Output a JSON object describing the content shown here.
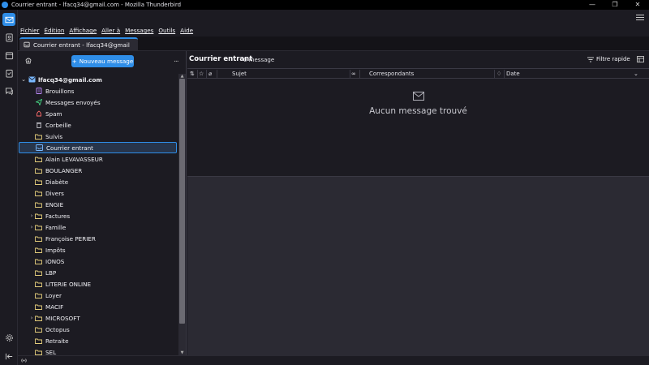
{
  "window": {
    "title": "Courrier entrant - lfacq34@gmail.com - Mozilla Thunderbird",
    "controls": [
      "—",
      "❐",
      "✕"
    ]
  },
  "menubar": [
    "Fichier",
    "Édition",
    "Affichage",
    "Aller à",
    "Messages",
    "Outils",
    "Aide"
  ],
  "tab": {
    "label": "Courrier entrant - lfacq34@gmail"
  },
  "folderpane": {
    "compose_label": "Nouveau message",
    "compose_plus": "+",
    "more": "...",
    "account": "lfacq34@gmail.com",
    "folders": [
      {
        "label": "Brouillons",
        "icon": "draft-icon",
        "color": "#c08cff",
        "expandable": false
      },
      {
        "label": "Messages envoyés",
        "icon": "sent-icon",
        "color": "#45d483",
        "expandable": false
      },
      {
        "label": "Spam",
        "icon": "spam-icon",
        "color": "#ff6b6b",
        "expandable": false
      },
      {
        "label": "Corbeille",
        "icon": "trash-icon",
        "color": "#c8c8cf",
        "expandable": false
      },
      {
        "label": "Suivis",
        "icon": "folder-icon",
        "color": "#e3cc7a",
        "expandable": false
      },
      {
        "label": "Courrier entrant",
        "icon": "inbox-icon",
        "color": "#79b8ff",
        "expandable": false,
        "selected": true
      },
      {
        "label": "Alain LEVAVASSEUR",
        "icon": "folder-icon",
        "color": "#e3cc7a",
        "expandable": false
      },
      {
        "label": "BOULANGER",
        "icon": "folder-icon",
        "color": "#e3cc7a",
        "expandable": false
      },
      {
        "label": "Diabète",
        "icon": "folder-icon",
        "color": "#e3cc7a",
        "expandable": false
      },
      {
        "label": "Divers",
        "icon": "folder-icon",
        "color": "#e3cc7a",
        "expandable": false
      },
      {
        "label": "ENGIE",
        "icon": "folder-icon",
        "color": "#e3cc7a",
        "expandable": false
      },
      {
        "label": "Factures",
        "icon": "folder-icon",
        "color": "#e3cc7a",
        "expandable": true
      },
      {
        "label": "Famille",
        "icon": "folder-icon",
        "color": "#e3cc7a",
        "expandable": true
      },
      {
        "label": "Françoise PERIER",
        "icon": "folder-icon",
        "color": "#e3cc7a",
        "expandable": false
      },
      {
        "label": "Impôts",
        "icon": "folder-icon",
        "color": "#e3cc7a",
        "expandable": false
      },
      {
        "label": "IONOS",
        "icon": "folder-icon",
        "color": "#e3cc7a",
        "expandable": false
      },
      {
        "label": "LBP",
        "icon": "folder-icon",
        "color": "#e3cc7a",
        "expandable": false
      },
      {
        "label": "LITERIE ONLINE",
        "icon": "folder-icon",
        "color": "#e3cc7a",
        "expandable": false
      },
      {
        "label": "Loyer",
        "icon": "folder-icon",
        "color": "#e3cc7a",
        "expandable": false
      },
      {
        "label": "MACIF",
        "icon": "folder-icon",
        "color": "#e3cc7a",
        "expandable": false
      },
      {
        "label": "MICROSOFT",
        "icon": "folder-icon",
        "color": "#e3cc7a",
        "expandable": true
      },
      {
        "label": "Octopus",
        "icon": "folder-icon",
        "color": "#e3cc7a",
        "expandable": false
      },
      {
        "label": "Retraite",
        "icon": "folder-icon",
        "color": "#e3cc7a",
        "expandable": false
      },
      {
        "label": "SEL",
        "icon": "folder-icon",
        "color": "#e3cc7a",
        "expandable": false
      }
    ]
  },
  "threadpane": {
    "title": "Courrier entrant",
    "count": "0 message",
    "quick_filter": "Filtre rapide",
    "columns": {
      "subject": "Sujet",
      "correspondents": "Correspondants",
      "date": "Date"
    },
    "empty_message": "Aucun message trouvé"
  },
  "colors": {
    "accent": "#2f8ee8",
    "background": "#1c1b22",
    "panel": "#2b2a33"
  }
}
